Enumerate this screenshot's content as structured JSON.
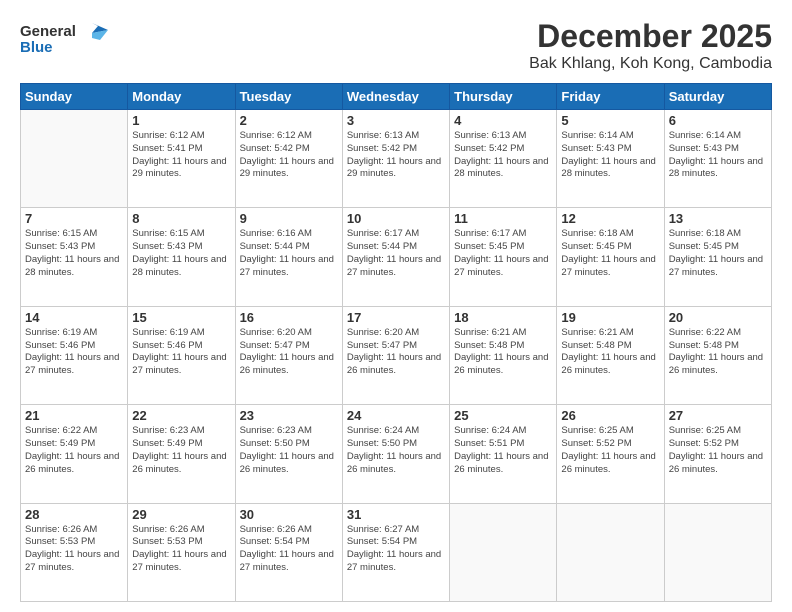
{
  "header": {
    "logo_general": "General",
    "logo_blue": "Blue",
    "month": "December 2025",
    "location": "Bak Khlang, Koh Kong, Cambodia"
  },
  "weekdays": [
    "Sunday",
    "Monday",
    "Tuesday",
    "Wednesday",
    "Thursday",
    "Friday",
    "Saturday"
  ],
  "weeks": [
    [
      {
        "day": "",
        "sunrise": "",
        "sunset": "",
        "daylight": ""
      },
      {
        "day": "1",
        "sunrise": "Sunrise: 6:12 AM",
        "sunset": "Sunset: 5:41 PM",
        "daylight": "Daylight: 11 hours and 29 minutes."
      },
      {
        "day": "2",
        "sunrise": "Sunrise: 6:12 AM",
        "sunset": "Sunset: 5:42 PM",
        "daylight": "Daylight: 11 hours and 29 minutes."
      },
      {
        "day": "3",
        "sunrise": "Sunrise: 6:13 AM",
        "sunset": "Sunset: 5:42 PM",
        "daylight": "Daylight: 11 hours and 29 minutes."
      },
      {
        "day": "4",
        "sunrise": "Sunrise: 6:13 AM",
        "sunset": "Sunset: 5:42 PM",
        "daylight": "Daylight: 11 hours and 28 minutes."
      },
      {
        "day": "5",
        "sunrise": "Sunrise: 6:14 AM",
        "sunset": "Sunset: 5:43 PM",
        "daylight": "Daylight: 11 hours and 28 minutes."
      },
      {
        "day": "6",
        "sunrise": "Sunrise: 6:14 AM",
        "sunset": "Sunset: 5:43 PM",
        "daylight": "Daylight: 11 hours and 28 minutes."
      }
    ],
    [
      {
        "day": "7",
        "sunrise": "Sunrise: 6:15 AM",
        "sunset": "Sunset: 5:43 PM",
        "daylight": "Daylight: 11 hours and 28 minutes."
      },
      {
        "day": "8",
        "sunrise": "Sunrise: 6:15 AM",
        "sunset": "Sunset: 5:43 PM",
        "daylight": "Daylight: 11 hours and 28 minutes."
      },
      {
        "day": "9",
        "sunrise": "Sunrise: 6:16 AM",
        "sunset": "Sunset: 5:44 PM",
        "daylight": "Daylight: 11 hours and 27 minutes."
      },
      {
        "day": "10",
        "sunrise": "Sunrise: 6:17 AM",
        "sunset": "Sunset: 5:44 PM",
        "daylight": "Daylight: 11 hours and 27 minutes."
      },
      {
        "day": "11",
        "sunrise": "Sunrise: 6:17 AM",
        "sunset": "Sunset: 5:45 PM",
        "daylight": "Daylight: 11 hours and 27 minutes."
      },
      {
        "day": "12",
        "sunrise": "Sunrise: 6:18 AM",
        "sunset": "Sunset: 5:45 PM",
        "daylight": "Daylight: 11 hours and 27 minutes."
      },
      {
        "day": "13",
        "sunrise": "Sunrise: 6:18 AM",
        "sunset": "Sunset: 5:45 PM",
        "daylight": "Daylight: 11 hours and 27 minutes."
      }
    ],
    [
      {
        "day": "14",
        "sunrise": "Sunrise: 6:19 AM",
        "sunset": "Sunset: 5:46 PM",
        "daylight": "Daylight: 11 hours and 27 minutes."
      },
      {
        "day": "15",
        "sunrise": "Sunrise: 6:19 AM",
        "sunset": "Sunset: 5:46 PM",
        "daylight": "Daylight: 11 hours and 27 minutes."
      },
      {
        "day": "16",
        "sunrise": "Sunrise: 6:20 AM",
        "sunset": "Sunset: 5:47 PM",
        "daylight": "Daylight: 11 hours and 26 minutes."
      },
      {
        "day": "17",
        "sunrise": "Sunrise: 6:20 AM",
        "sunset": "Sunset: 5:47 PM",
        "daylight": "Daylight: 11 hours and 26 minutes."
      },
      {
        "day": "18",
        "sunrise": "Sunrise: 6:21 AM",
        "sunset": "Sunset: 5:48 PM",
        "daylight": "Daylight: 11 hours and 26 minutes."
      },
      {
        "day": "19",
        "sunrise": "Sunrise: 6:21 AM",
        "sunset": "Sunset: 5:48 PM",
        "daylight": "Daylight: 11 hours and 26 minutes."
      },
      {
        "day": "20",
        "sunrise": "Sunrise: 6:22 AM",
        "sunset": "Sunset: 5:48 PM",
        "daylight": "Daylight: 11 hours and 26 minutes."
      }
    ],
    [
      {
        "day": "21",
        "sunrise": "Sunrise: 6:22 AM",
        "sunset": "Sunset: 5:49 PM",
        "daylight": "Daylight: 11 hours and 26 minutes."
      },
      {
        "day": "22",
        "sunrise": "Sunrise: 6:23 AM",
        "sunset": "Sunset: 5:49 PM",
        "daylight": "Daylight: 11 hours and 26 minutes."
      },
      {
        "day": "23",
        "sunrise": "Sunrise: 6:23 AM",
        "sunset": "Sunset: 5:50 PM",
        "daylight": "Daylight: 11 hours and 26 minutes."
      },
      {
        "day": "24",
        "sunrise": "Sunrise: 6:24 AM",
        "sunset": "Sunset: 5:50 PM",
        "daylight": "Daylight: 11 hours and 26 minutes."
      },
      {
        "day": "25",
        "sunrise": "Sunrise: 6:24 AM",
        "sunset": "Sunset: 5:51 PM",
        "daylight": "Daylight: 11 hours and 26 minutes."
      },
      {
        "day": "26",
        "sunrise": "Sunrise: 6:25 AM",
        "sunset": "Sunset: 5:52 PM",
        "daylight": "Daylight: 11 hours and 26 minutes."
      },
      {
        "day": "27",
        "sunrise": "Sunrise: 6:25 AM",
        "sunset": "Sunset: 5:52 PM",
        "daylight": "Daylight: 11 hours and 26 minutes."
      }
    ],
    [
      {
        "day": "28",
        "sunrise": "Sunrise: 6:26 AM",
        "sunset": "Sunset: 5:53 PM",
        "daylight": "Daylight: 11 hours and 27 minutes."
      },
      {
        "day": "29",
        "sunrise": "Sunrise: 6:26 AM",
        "sunset": "Sunset: 5:53 PM",
        "daylight": "Daylight: 11 hours and 27 minutes."
      },
      {
        "day": "30",
        "sunrise": "Sunrise: 6:26 AM",
        "sunset": "Sunset: 5:54 PM",
        "daylight": "Daylight: 11 hours and 27 minutes."
      },
      {
        "day": "31",
        "sunrise": "Sunrise: 6:27 AM",
        "sunset": "Sunset: 5:54 PM",
        "daylight": "Daylight: 11 hours and 27 minutes."
      },
      {
        "day": "",
        "sunrise": "",
        "sunset": "",
        "daylight": ""
      },
      {
        "day": "",
        "sunrise": "",
        "sunset": "",
        "daylight": ""
      },
      {
        "day": "",
        "sunrise": "",
        "sunset": "",
        "daylight": ""
      }
    ]
  ]
}
